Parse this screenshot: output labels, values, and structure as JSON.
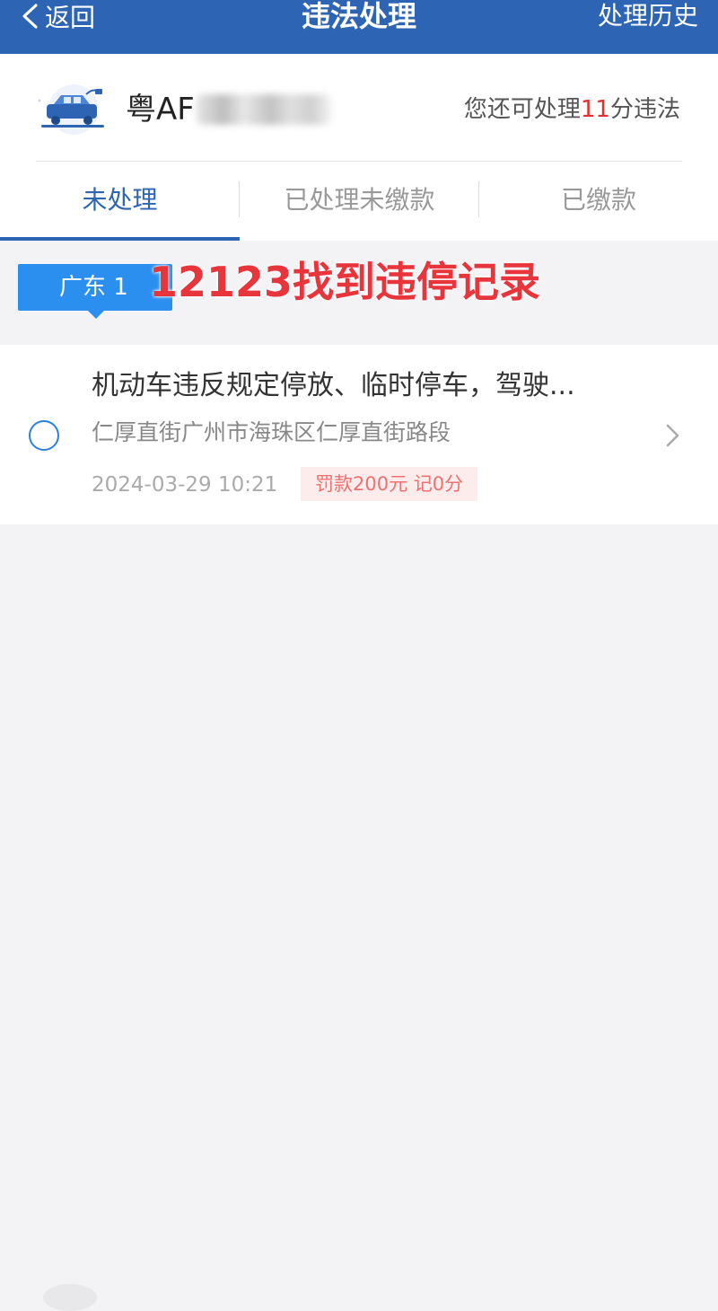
{
  "nav": {
    "back_label": "返回",
    "title": "违法处理",
    "history_label": "处理历史"
  },
  "vehicle": {
    "plate_prefix": "粤AF",
    "points_prefix": "您还可处理",
    "points_value": "11",
    "points_suffix": "分违法"
  },
  "tabs": [
    {
      "label": "未处理",
      "active": true
    },
    {
      "label": "已处理未缴款",
      "active": false
    },
    {
      "label": "已缴款",
      "active": false
    }
  ],
  "region": {
    "label": "广东 1"
  },
  "overlay_caption": "12123找到违停记录",
  "records": [
    {
      "title": "机动车违反规定停放、临时停车，驾驶...",
      "location": "仁厚直街广州市海珠区仁厚直街路段",
      "time": "2024-03-29 10:21",
      "fine": "罚款200元 记0分"
    }
  ],
  "colors": {
    "primary": "#2d64b3",
    "region_tag": "#2b8ff0",
    "highlight_red": "#e03030",
    "caption_red": "#e8343b",
    "fine_bg": "#fdecec",
    "fine_text": "#f07070",
    "background": "#f3f3f6"
  },
  "icons": {
    "back": "chevron-left-icon",
    "vehicle": "electric-car-icon",
    "radio": "radio-unchecked-icon",
    "arrow": "chevron-right-icon"
  }
}
